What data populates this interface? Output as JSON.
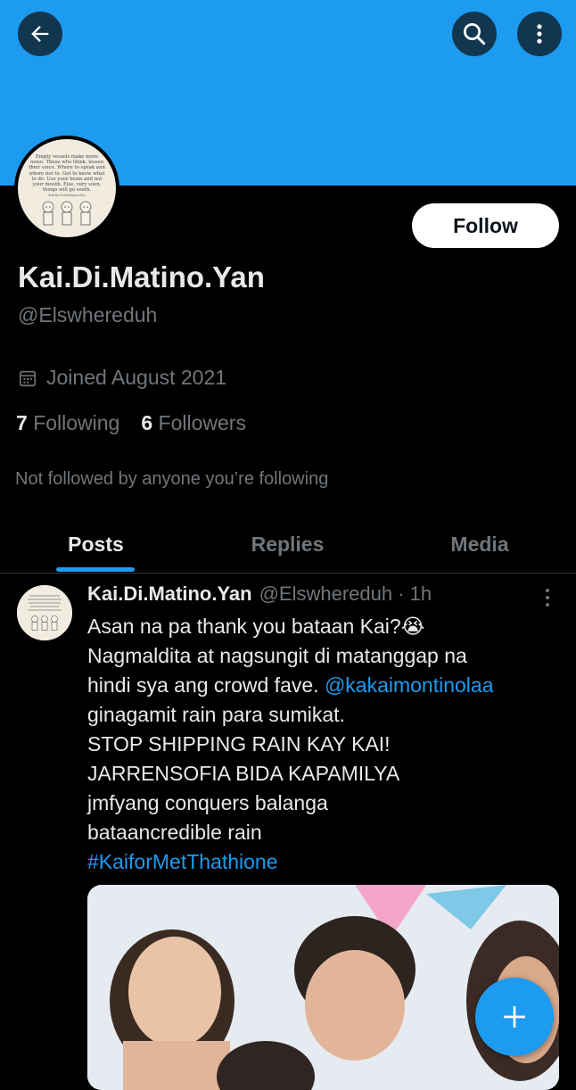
{
  "header": {
    "back_icon": "arrow-left-icon",
    "search_icon": "search-icon",
    "more_icon": "more-vertical-icon",
    "banner_color": "#1d9bf0"
  },
  "profile": {
    "avatar_quote": "Empty vessels make more noise. Those who think, lessen their voice. Where to speak and where not to. Got to know what to do. Use your brain and not your mouth. Else, very soon, things will go south.",
    "avatar_credit": "- Kaitlin Fernhemworthy -",
    "follow_label": "Follow",
    "display_name": "Kai.Di.Matino.Yan",
    "handle": "@Elswhereduh",
    "joined": "Joined August 2021",
    "following_count": "7",
    "following_label": "Following",
    "followers_count": "6",
    "followers_label": "Followers",
    "not_followed_text": "Not followed by anyone you’re following"
  },
  "tabs": [
    {
      "label": "Posts",
      "active": true
    },
    {
      "label": "Replies",
      "active": false
    },
    {
      "label": "Media",
      "active": false
    }
  ],
  "post": {
    "author_name": "Kai.Di.Matino.Yan",
    "meta": "@Elswhereduh · 1h",
    "line1": "Asan na pa thank you bataan Kai?😭",
    "line2": "Nagmaldita at nagsungit di matanggap na",
    "line3_text": "hindi sya ang crowd fave. ",
    "line3_mention": "@kakaimontinolaa",
    "line4": "ginagamit rain para sumikat.",
    "line5": "STOP SHIPPING RAIN KAY KAI!",
    "line6": "JARRENSOFIA BIDA KAPAMILYA",
    "line7": "jmfyang conquers balanga",
    "line8": "bataancredible rain",
    "hashtag": "#KaiforMetThathione"
  },
  "fab": {
    "icon": "plus-icon",
    "color": "#1d9bf0"
  }
}
